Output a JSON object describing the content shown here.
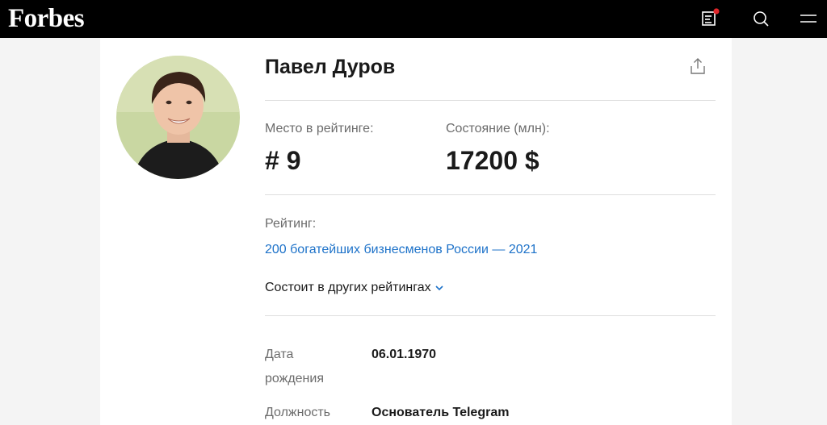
{
  "header": {
    "logo_text": "Forbes",
    "icons": [
      "news-feed-icon",
      "search-icon",
      "menu-icon"
    ],
    "notification_color": "#e0262a"
  },
  "profile": {
    "name": "Павел Дуров",
    "rank_label": "Место в рейтинге:",
    "rank_value": "# 9",
    "worth_label": "Состояние (млн):",
    "worth_value": "17200 $",
    "rating_label": "Рейтинг:",
    "rating_link": "200 богатейших бизнесменов России — 2021",
    "other_ratings": "Состоит в других рейтингах",
    "info": {
      "birth_label_line1": "Дата",
      "birth_label_line2": "рождения",
      "birth_value": "06.01.1970",
      "position_label": "Должность",
      "position_value": "Основатель Telegram"
    }
  },
  "colors": {
    "link": "#1d72c9",
    "header_bg": "#000000"
  }
}
